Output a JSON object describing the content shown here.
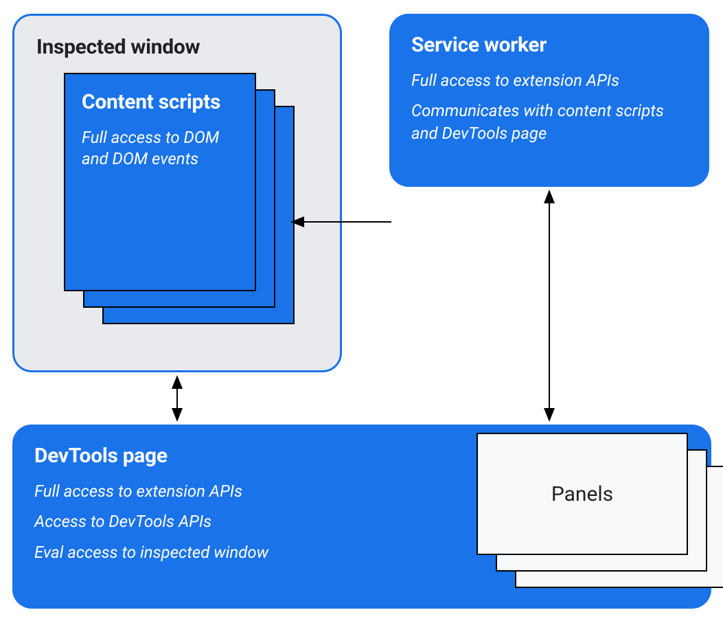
{
  "inspected_window": {
    "title": "Inspected window",
    "content_scripts": {
      "title": "Content scripts",
      "desc": "Full access to DOM and DOM events"
    }
  },
  "service_worker": {
    "title": "Service worker",
    "desc1": "Full access to extension APIs",
    "desc2": "Communicates with content scripts and DevTools page"
  },
  "devtools_page": {
    "title": "DevTools page",
    "desc1": "Full access to extension APIs",
    "desc2": "Access to DevTools APIs",
    "desc3": "Eval access to inspected window",
    "panels_label": "Panels"
  }
}
